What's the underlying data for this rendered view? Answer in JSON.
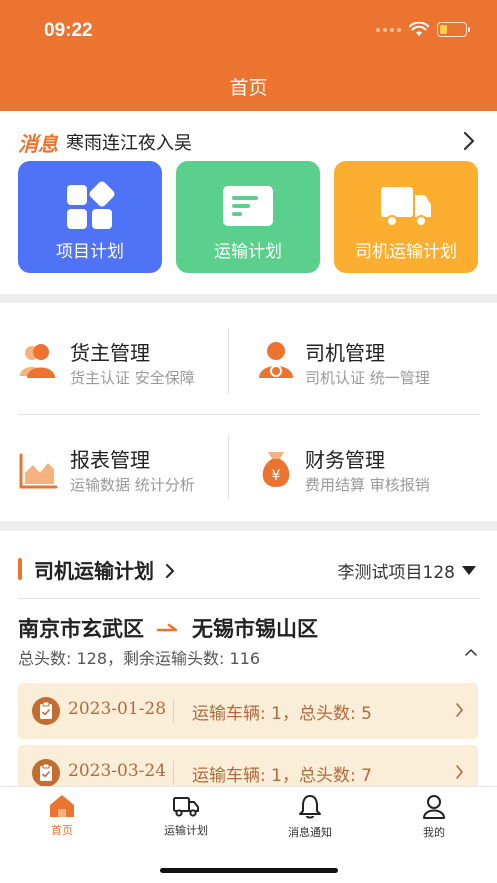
{
  "status": {
    "time": "09:22"
  },
  "header": {
    "title": "首页"
  },
  "notice": {
    "tag": "消息",
    "text": "寒雨连江夜入吴"
  },
  "tiles": [
    {
      "label": "项目计划",
      "color": "#4f73f7",
      "icon": "grid-icon"
    },
    {
      "label": "运输计划",
      "color": "#5bd08c",
      "icon": "document-icon"
    },
    {
      "label": "司机运输计划",
      "color": "#fbae2f",
      "icon": "truck-icon"
    }
  ],
  "management": [
    {
      "title": "货主管理",
      "subtitle": "货主认证 安全保障",
      "icon": "users-icon"
    },
    {
      "title": "司机管理",
      "subtitle": "司机认证 统一管理",
      "icon": "driver-icon"
    },
    {
      "title": "报表管理",
      "subtitle": "运输数据 统计分析",
      "icon": "area-chart-icon"
    },
    {
      "title": "财务管理",
      "subtitle": "费用结算 审核报销",
      "icon": "money-bag-icon"
    }
  ],
  "plan": {
    "title": "司机运输计划",
    "project": "李测试项目128",
    "origin": "南京市玄武区",
    "destination": "无锡市锡山区",
    "heads": "总头数: 128，剩余运输头数: 116",
    "trips": [
      {
        "date": "2023-01-28",
        "info": "运输车辆: 1，总头数: 5"
      },
      {
        "date": "2023-03-24",
        "info": "运输车辆: 1，总头数: 7"
      }
    ]
  },
  "tabbar": [
    {
      "label": "首页",
      "icon": "home-icon",
      "active": true
    },
    {
      "label": "运输计划",
      "icon": "truck-icon",
      "active": false
    },
    {
      "label": "消息通知",
      "icon": "bell-icon",
      "active": false
    },
    {
      "label": "我的",
      "icon": "user-icon",
      "active": false
    }
  ],
  "colors": {
    "primary": "#ec7431",
    "trip_bg": "#fbeed8"
  }
}
